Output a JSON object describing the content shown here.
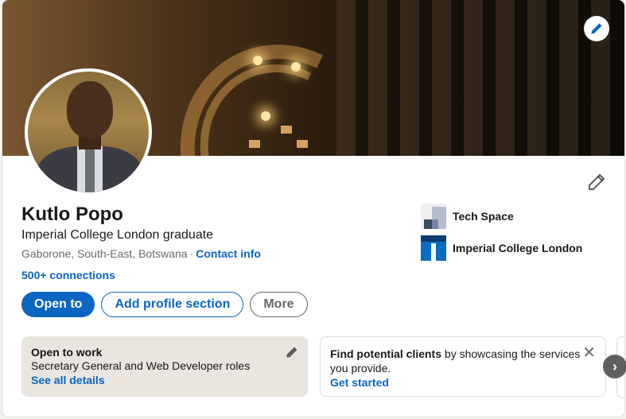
{
  "profile": {
    "name": "Kutlo Popo",
    "headline": "Imperial College London graduate",
    "location": "Gaborone, South-East, Botswana",
    "separator": "·",
    "contact_info": "Contact info",
    "connections": "500+ connections"
  },
  "companies": [
    {
      "name": "Tech Space",
      "logo_icon": "tech-space-logo"
    },
    {
      "name": "Imperial College London",
      "logo_icon": "imperial-college-logo"
    }
  ],
  "actions": {
    "open_to": "Open to",
    "add_section": "Add profile section",
    "more": "More"
  },
  "open_to_work": {
    "title": "Open to work",
    "roles": "Secretary General and Web Developer roles",
    "link": "See all details"
  },
  "clients": {
    "title": "Find potential clients",
    "text": " by showcasing the services you provide.",
    "link": "Get started",
    "close": "✕"
  },
  "nav": {
    "next": "›"
  },
  "colors": {
    "accent": "#0a66c2",
    "card_bg": "#ffffff",
    "open_card_bg": "#e9e5df"
  }
}
